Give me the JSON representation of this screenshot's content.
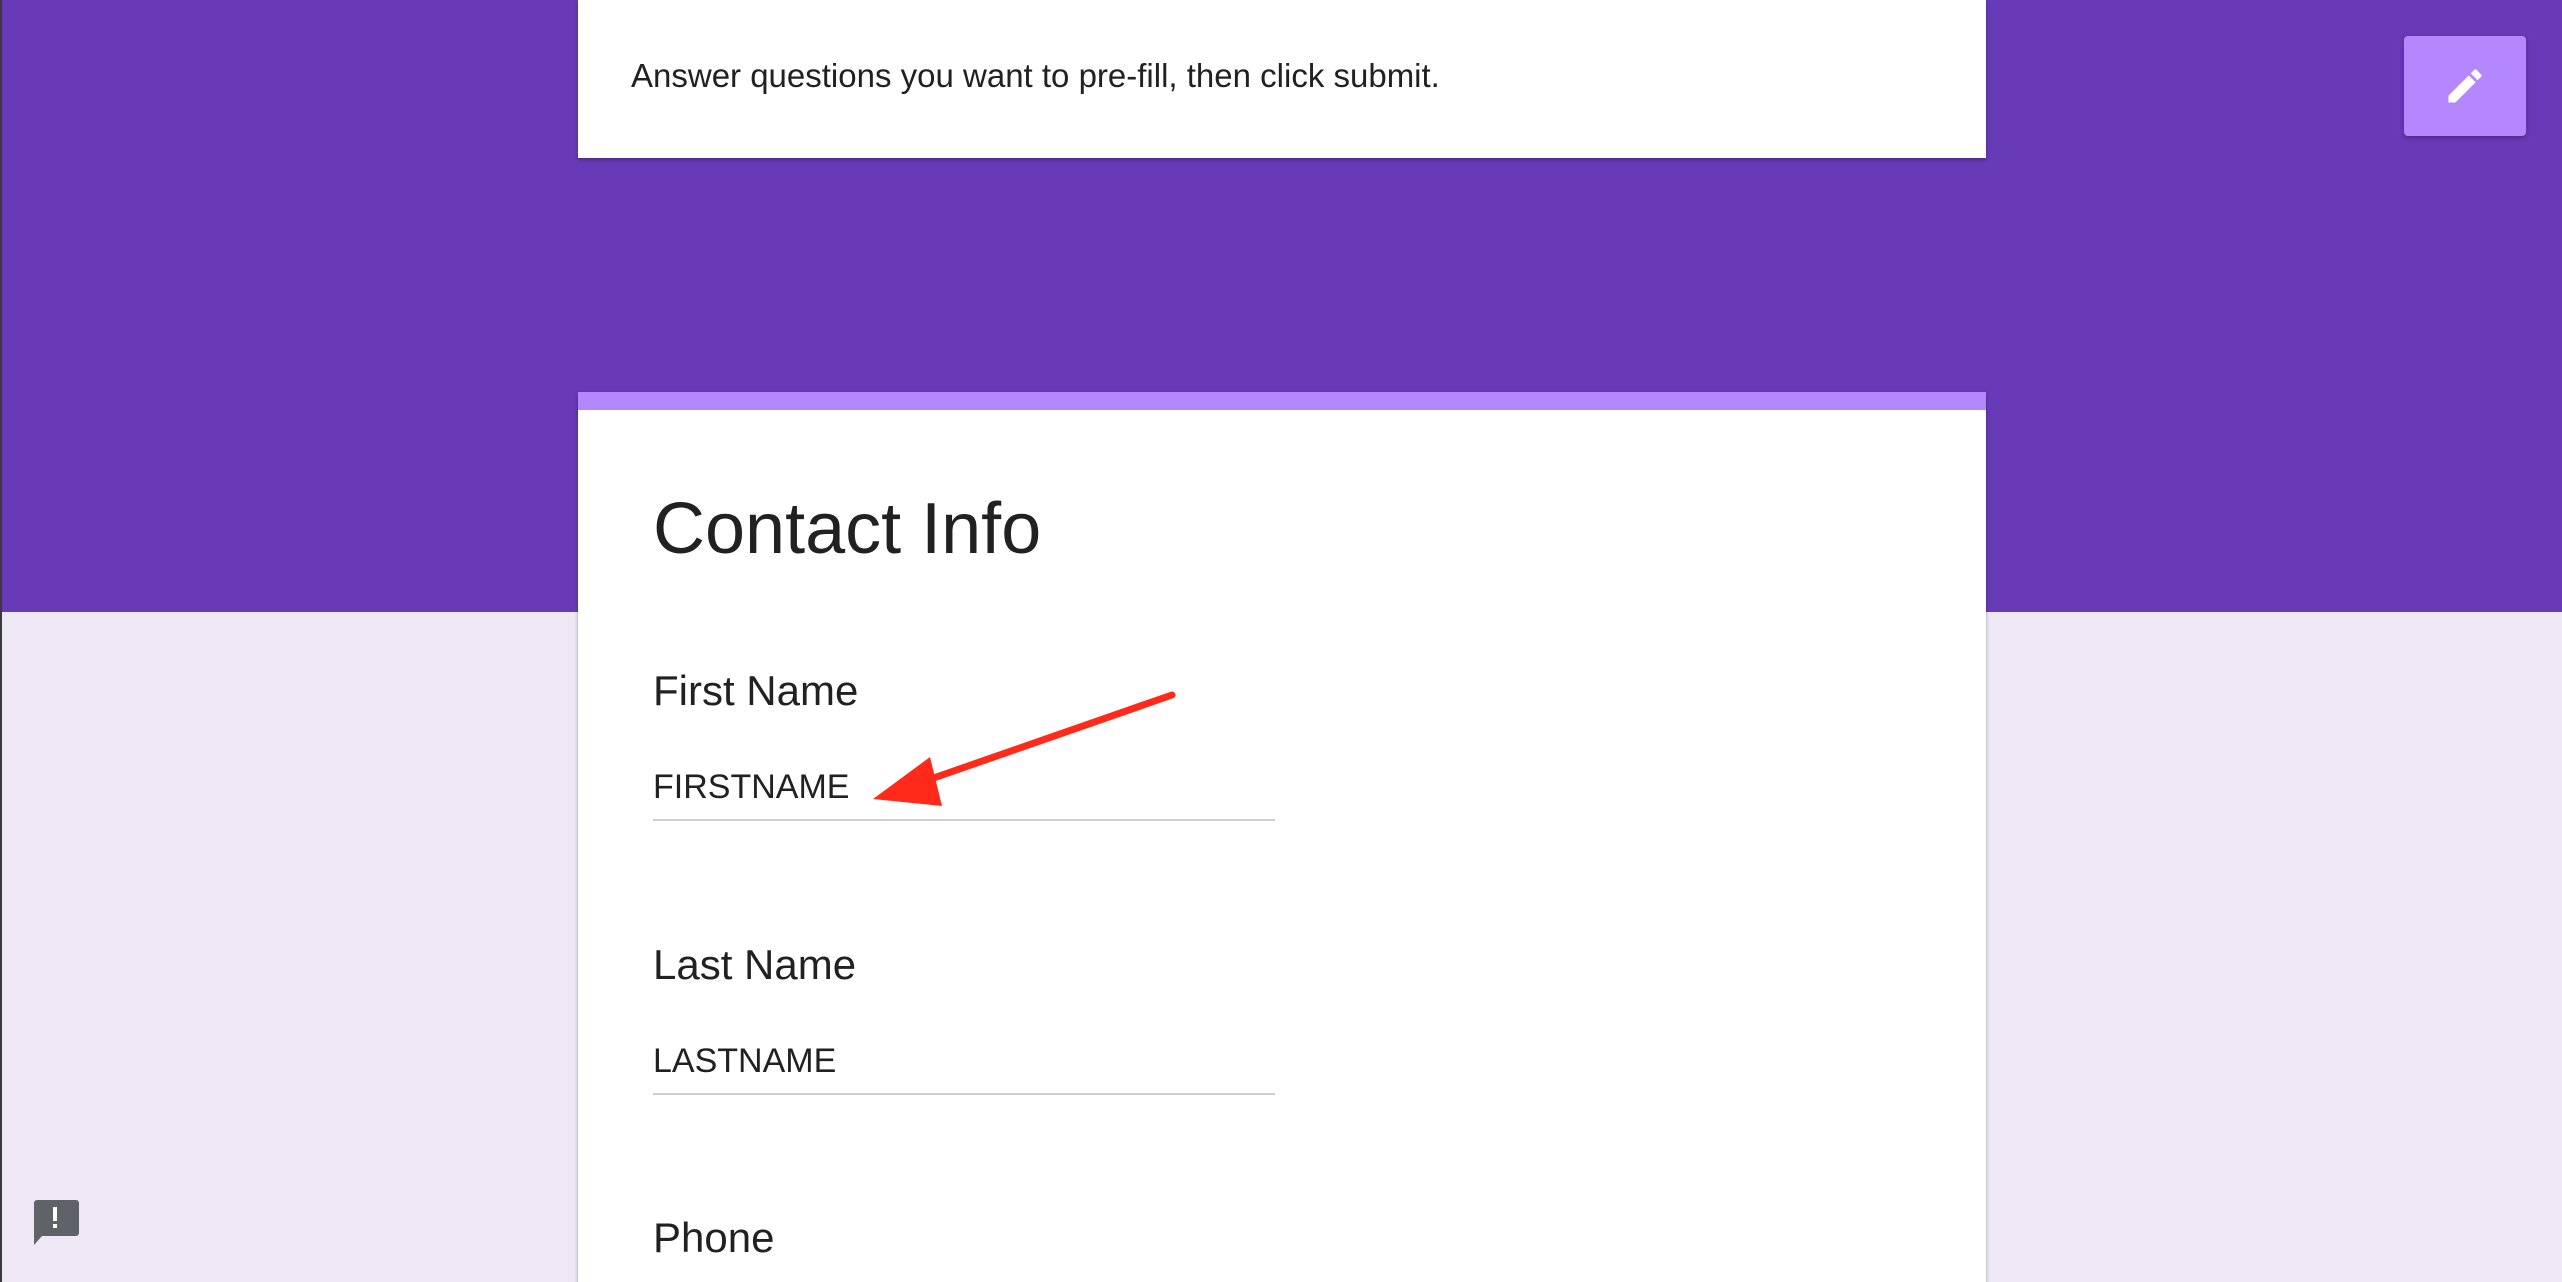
{
  "intro": {
    "text": "Answer questions you want to pre-fill, then click submit."
  },
  "section": {
    "title": "Contact Info"
  },
  "questions": [
    {
      "label": "First Name",
      "value": "FIRSTNAME"
    },
    {
      "label": "Last Name",
      "value": "LASTNAME"
    },
    {
      "label": "Phone"
    }
  ],
  "colors": {
    "header_band": "#673ab7",
    "accent": "#b388ff",
    "page_background": "#ede7f6",
    "annotation_arrow": "#ff2a1a"
  },
  "icons": {
    "edit_button": "pencil-icon",
    "feedback_button": "report-feedback-icon"
  }
}
